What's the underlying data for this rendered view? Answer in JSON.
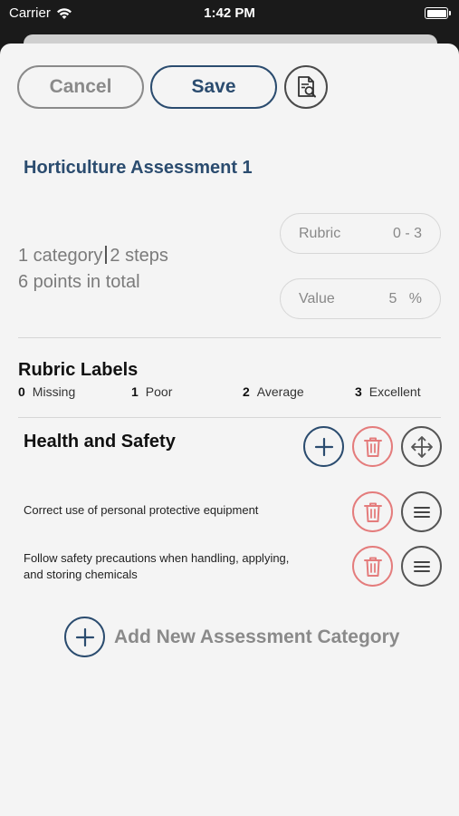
{
  "status_bar": {
    "carrier": "Carrier",
    "time": "1:42 PM"
  },
  "toolbar": {
    "cancel_label": "Cancel",
    "save_label": "Save",
    "preview_icon": "document-search-icon"
  },
  "assessment": {
    "title": "Horticulture Assessment 1",
    "category_count": "1 category",
    "step_count": "2 steps",
    "points_total": "6 points in total",
    "rubric": {
      "label": "Rubric",
      "value": "0 - 3"
    },
    "weight": {
      "label": "Value",
      "value": "5",
      "unit": "%"
    }
  },
  "rubric_labels": {
    "heading": "Rubric Labels",
    "levels": [
      {
        "score": "0",
        "label": "Missing"
      },
      {
        "score": "1",
        "label": "Poor"
      },
      {
        "score": "2",
        "label": "Average"
      },
      {
        "score": "3",
        "label": "Excellent"
      }
    ]
  },
  "categories": [
    {
      "title": "Health and Safety",
      "steps": [
        {
          "text": "Correct use of personal protective equipment"
        },
        {
          "text": "Follow safety precautions when handling, applying, and storing chemicals"
        }
      ]
    }
  ],
  "add_category_label": "Add New Assessment Category",
  "colors": {
    "accent": "#2b4c6f",
    "danger": "#e47c7c",
    "muted": "#8a8a8a",
    "sheet": "#f4f4f4"
  }
}
